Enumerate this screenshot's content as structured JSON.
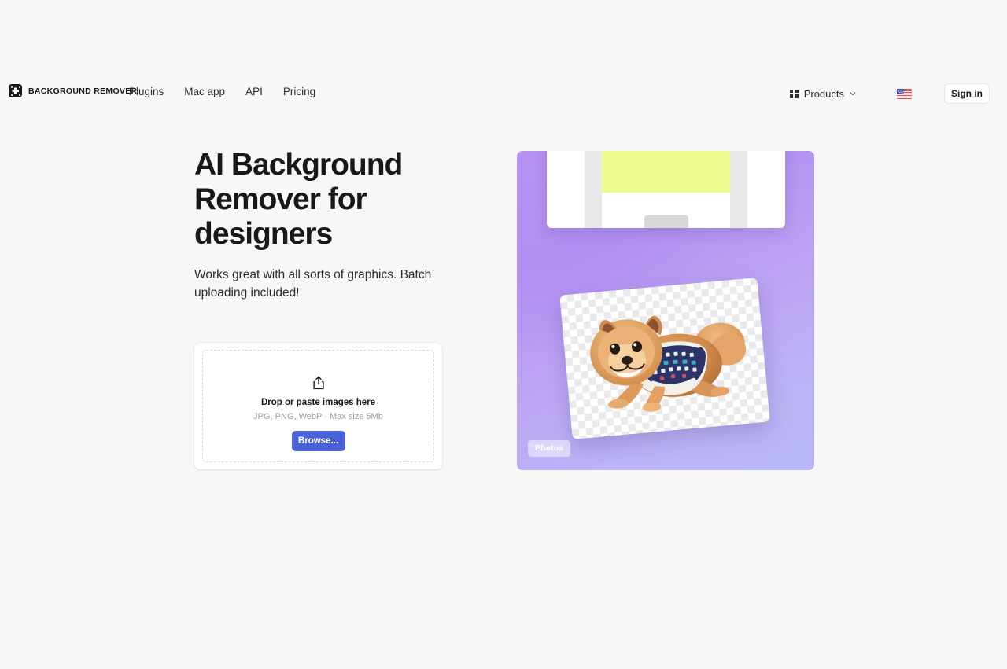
{
  "page": {
    "background": "#f7f7f7"
  },
  "header": {
    "brand": {
      "name": "BACKGROUND REMOVER",
      "logo_icon": "background-remover-logo-icon"
    },
    "nav_links": [
      {
        "label": "Plugins"
      },
      {
        "label": "Mac app"
      },
      {
        "label": "API"
      },
      {
        "label": "Pricing"
      }
    ],
    "products": {
      "label": "Products",
      "grid_icon": "grid-icon",
      "chevron_icon": "chevron-down-icon"
    },
    "language": {
      "flag_icon": "us-flag-icon",
      "country": "United States"
    },
    "sign_in": {
      "label": "Sign in"
    }
  },
  "hero": {
    "headline": "AI Background Remover for designers",
    "subheadline": "Works great with all sorts of graphics. Batch uploading included!",
    "dropzone": {
      "upload_icon": "upload-share-icon",
      "title": "Drop or paste images here",
      "formats": "JPG, PNG, WebP · Max size 5Mb",
      "browse_label": "Browse..."
    },
    "preview": {
      "badge": "Photos",
      "gradient_from": "#ae88f2",
      "gradient_to": "#b9b8f6",
      "panel_color": "#eef98f",
      "button_color": "#0fc878"
    }
  },
  "colors": {
    "accent_blue": "#4a62d8",
    "text_primary": "#17181a",
    "text_muted": "#9a9aa2"
  }
}
